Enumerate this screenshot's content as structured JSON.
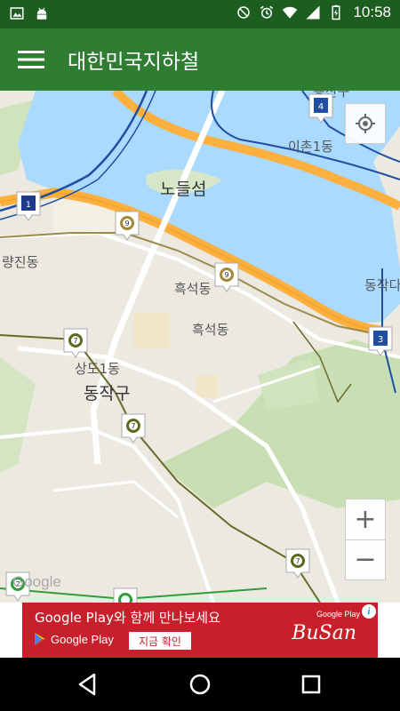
{
  "status_bar": {
    "time": "10:58",
    "left_icons": [
      "image-icon",
      "android-icon"
    ],
    "right_icons": [
      "do-not-disturb-icon",
      "alarm-icon",
      "wifi-icon",
      "signal-icon",
      "battery-icon"
    ]
  },
  "app_bar": {
    "title": "대한민국지하철",
    "menu_icon": "hamburger-menu-icon",
    "color": "#2e7d32"
  },
  "map": {
    "labels": {
      "nodeulseom": "노들섬",
      "ichon1dong": "이촌1동",
      "noryangjindong": "량진동",
      "heukseokdong_upper": "흑석동",
      "heukseokdong": "흑석동",
      "dongjak_right": "동작다",
      "sangdo1dong": "상도1동",
      "dongjakgu": "동작구",
      "yongsangu_partial": "용산구"
    },
    "markers": [
      {
        "line": "4",
        "color": "#1e4fa0"
      },
      {
        "line": "1/9",
        "color": "#1e3a8a"
      },
      {
        "line": "9",
        "color": "#a38a3a"
      },
      {
        "line": "9",
        "color": "#a38a3a"
      },
      {
        "line": "4/3",
        "color": "#1e4fa0"
      },
      {
        "line": "7",
        "color": "#5b6a1e"
      },
      {
        "line": "7",
        "color": "#5b6a1e"
      },
      {
        "line": "7",
        "color": "#5b6a1e"
      },
      {
        "line": "2",
        "color": "#2e9d3a"
      },
      {
        "line": "2",
        "color": "#2e9d3a"
      }
    ],
    "zoom_in": "+",
    "zoom_out": "−",
    "google": "Google"
  },
  "ad": {
    "headline": "Google Play와 함께 만나보세요",
    "store": "Google Play",
    "cta": "지금 확인",
    "brand": "BuSan",
    "store_small": "Google Play",
    "info": "i",
    "color": "#c8202a"
  },
  "nav": {
    "back": "back-icon",
    "home": "home-icon",
    "recents": "recents-icon"
  }
}
